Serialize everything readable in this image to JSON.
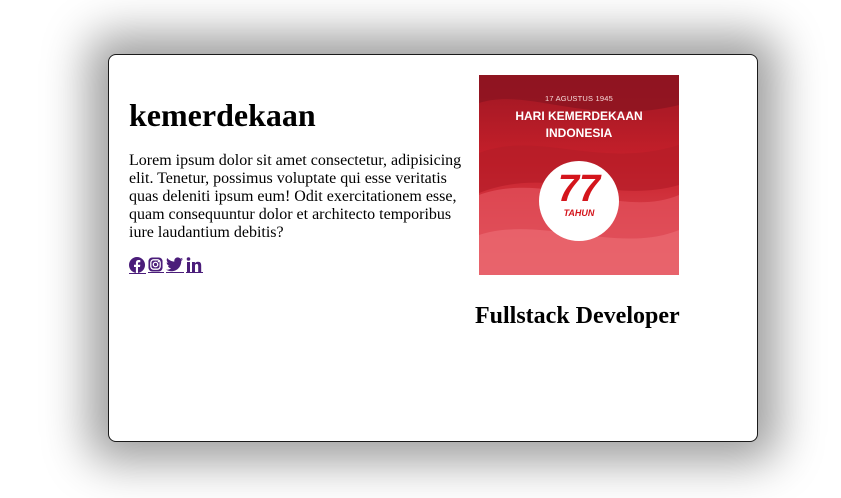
{
  "card": {
    "title": "kemerdekaan",
    "description": "Lorem ipsum dolor sit amet consectetur, adipisicing elit. Tenetur, possimus voluptate qui esse veritatis quas deleniti ipsum eum! Odit exercitationem esse, quam consequuntur dolor et architecto temporibus iure laudantium debitis?",
    "social_icons": [
      "facebook-icon",
      "instagram-icon",
      "twitter-icon",
      "linkedin-icon"
    ],
    "poster": {
      "date": "17 AGUSTUS 1945",
      "heading_line1": "HARI KEMERDEKAAN",
      "heading_line2": "INDONESIA",
      "number": "77",
      "unit": "TAHUN"
    },
    "role": "Fullstack Developer"
  },
  "colors": {
    "social_icon": "#4b1d7a",
    "poster_red": "#c8202b",
    "poster_number": "#d4151c"
  }
}
